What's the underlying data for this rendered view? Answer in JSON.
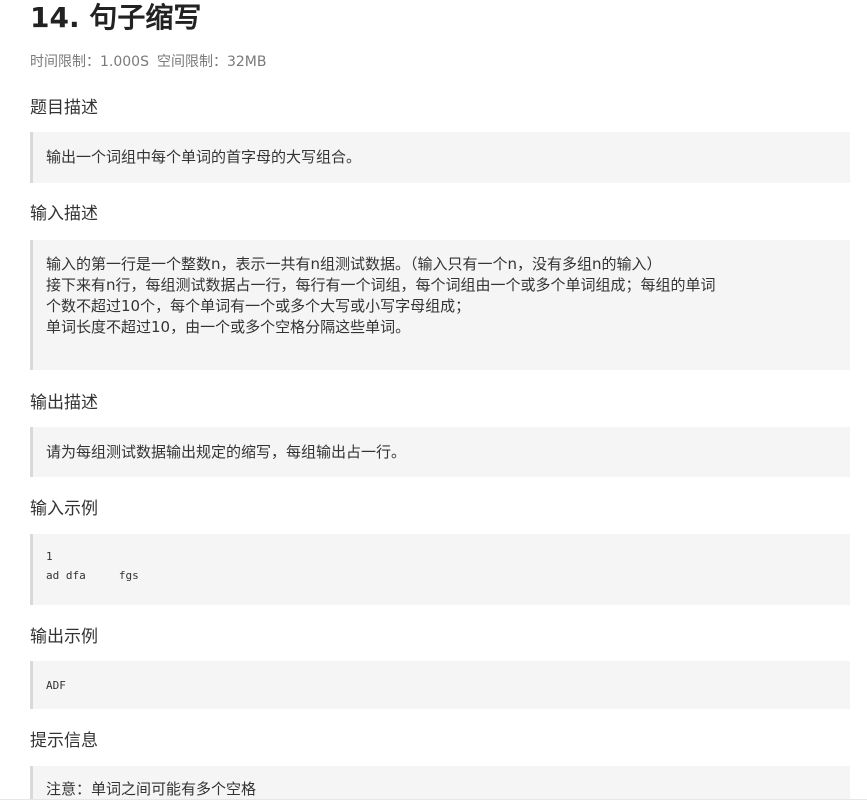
{
  "problem": {
    "title": "14. 句子缩写",
    "time_limit": "时间限制：1.000S",
    "memory_limit": "空间限制：32MB"
  },
  "sections": {
    "description": {
      "heading": "题目描述",
      "text": "输出一个词组中每个单词的首字母的大写组合。"
    },
    "input": {
      "heading": "输入描述",
      "line1": "输入的第一行是一个整数n，表示一共有n组测试数据。（输入只有一个n，没有多组n的输入）",
      "line2": "接下来有n行，每组测试数据占一行，每行有一个词组，每个词组由一个或多个单词组成；每组的单词",
      "line3": "个数不超过10个，每个单词有一个或多个大写或小写字母组成；",
      "line4": "单词长度不超过10，由一个或多个空格分隔这些单词。"
    },
    "output": {
      "heading": "输出描述",
      "text": "请为每组测试数据输出规定的缩写，每组输出占一行。"
    },
    "sample_input": {
      "heading": "输入示例",
      "line1": "1",
      "line2": "ad dfa     fgs"
    },
    "sample_output": {
      "heading": "输出示例",
      "text": "ADF"
    },
    "hint": {
      "heading": "提示信息",
      "text": "注意：单词之间可能有多个空格"
    }
  }
}
